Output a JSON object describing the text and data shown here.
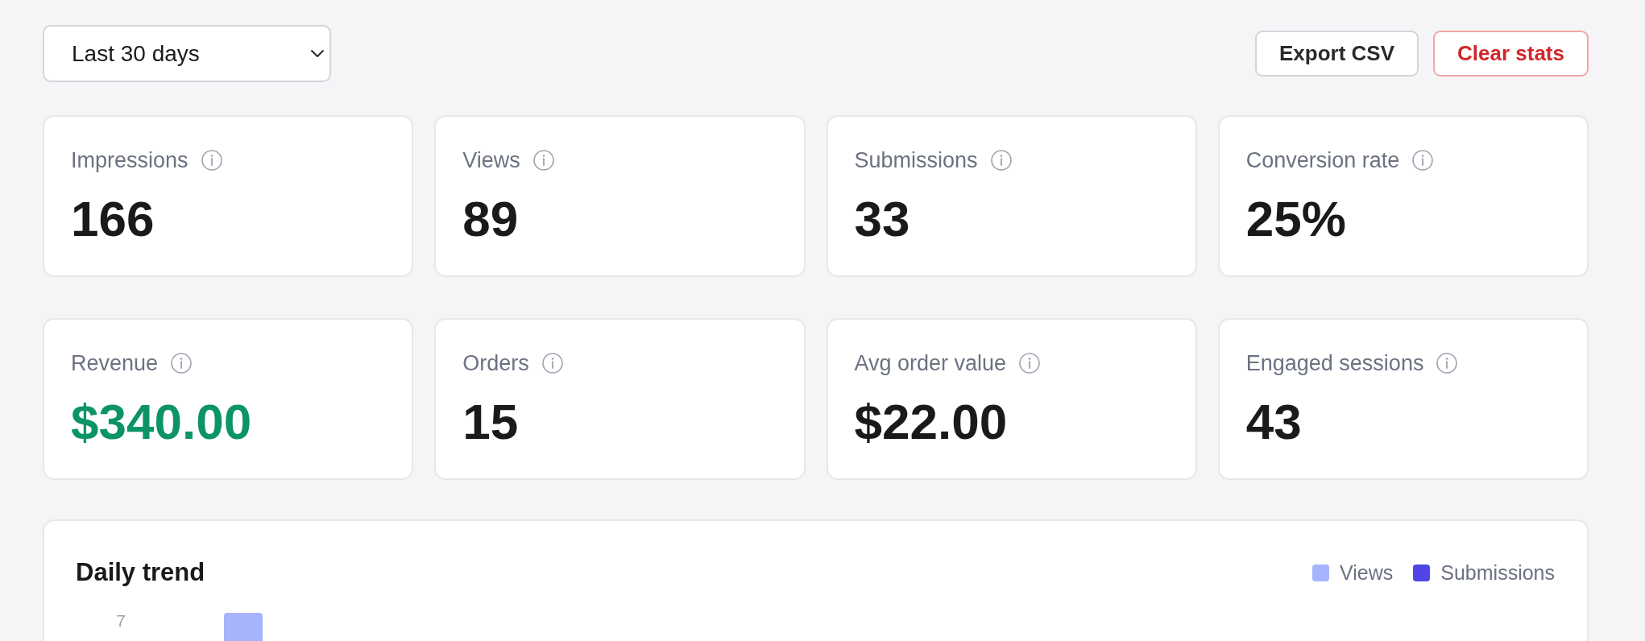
{
  "toolbar": {
    "date_range": {
      "value": "Last 30 days"
    },
    "actions": [
      {
        "label": "Export CSV",
        "kind": "secondary"
      },
      {
        "label": "Clear stats",
        "kind": "danger"
      }
    ]
  },
  "metrics": [
    {
      "label": "Impressions",
      "value": "166",
      "positive": false
    },
    {
      "label": "Views",
      "value": "89",
      "positive": false
    },
    {
      "label": "Submissions",
      "value": "33",
      "positive": false
    },
    {
      "label": "Conversion rate",
      "value": "25%",
      "positive": false
    },
    {
      "label": "Revenue",
      "value": "$340.00",
      "positive": true
    },
    {
      "label": "Orders",
      "value": "15",
      "positive": false
    },
    {
      "label": "Avg order value",
      "value": "$22.00",
      "positive": false
    },
    {
      "label": "Engaged sessions",
      "value": "43",
      "positive": false
    }
  ],
  "chart": {
    "title": "Daily trend",
    "legend": [
      {
        "label": "Views",
        "color": "#a5b4fc"
      },
      {
        "label": "Submissions",
        "color": "#4f46e5"
      }
    ],
    "y_axis_labels": [
      "7"
    ]
  }
}
